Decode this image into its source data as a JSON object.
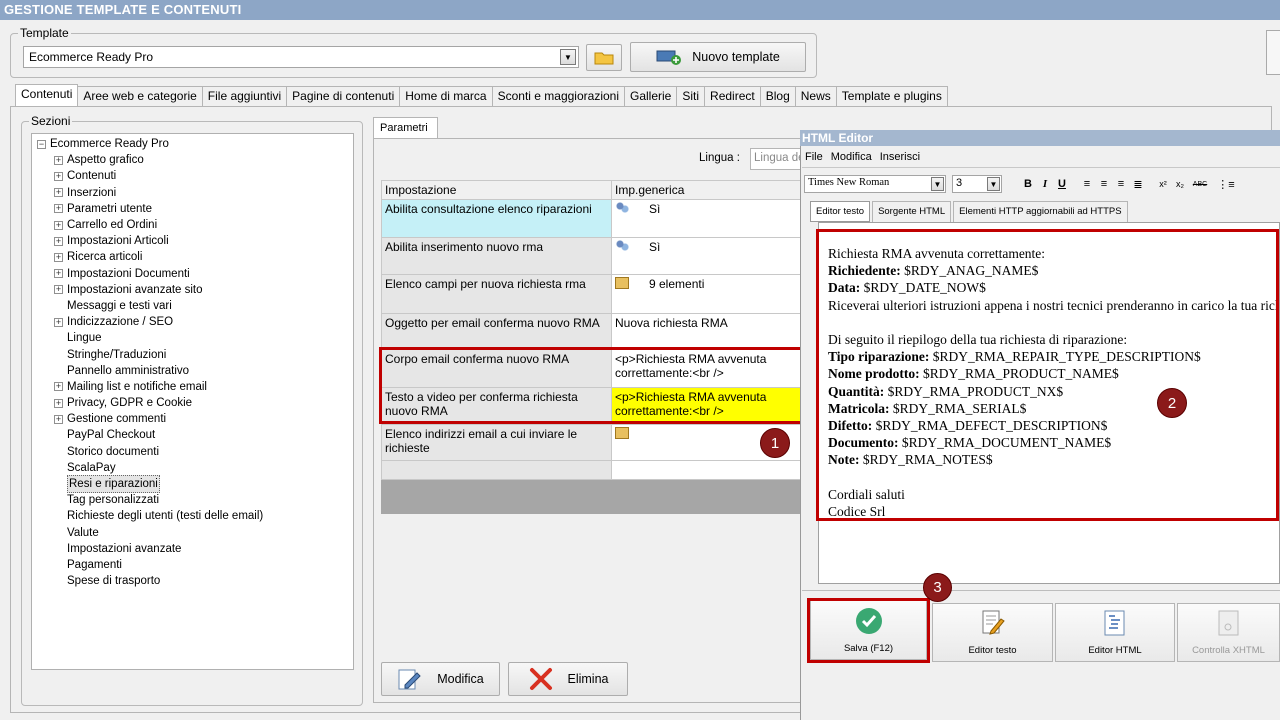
{
  "window": {
    "title": "GESTIONE TEMPLATE E CONTENUTI"
  },
  "template_group": {
    "label": "Template",
    "selected": "Ecommerce Ready Pro",
    "new_button": "Nuovo template"
  },
  "main_tabs": [
    "Contenuti",
    "Aree web e categorie",
    "File aggiuntivi",
    "Pagine di contenuti",
    "Home di marca",
    "Sconti e maggiorazioni",
    "Gallerie",
    "Siti",
    "Redirect",
    "Blog",
    "News",
    "Template e plugins"
  ],
  "sections": {
    "label": "Sezioni",
    "root": "Ecommerce Ready Pro",
    "items": [
      {
        "label": "Aspetto grafico",
        "expandable": true
      },
      {
        "label": "Contenuti",
        "expandable": true
      },
      {
        "label": "Inserzioni",
        "expandable": true
      },
      {
        "label": "Parametri utente",
        "expandable": true
      },
      {
        "label": "Carrello ed Ordini",
        "expandable": true
      },
      {
        "label": "Impostazioni Articoli",
        "expandable": true
      },
      {
        "label": "Ricerca articoli",
        "expandable": true
      },
      {
        "label": "Impostazioni Documenti",
        "expandable": true
      },
      {
        "label": "Impostazioni avanzate sito",
        "expandable": true
      },
      {
        "label": "Messaggi e testi vari",
        "expandable": false
      },
      {
        "label": "Indicizzazione / SEO",
        "expandable": true
      },
      {
        "label": "Lingue",
        "expandable": false
      },
      {
        "label": "Stringhe/Traduzioni",
        "expandable": false
      },
      {
        "label": "Pannello amministrativo",
        "expandable": false
      },
      {
        "label": "Mailing list e notifiche email",
        "expandable": true
      },
      {
        "label": "Privacy, GDPR e Cookie",
        "expandable": true
      },
      {
        "label": "Gestione commenti",
        "expandable": true
      },
      {
        "label": "PayPal Checkout",
        "expandable": false
      },
      {
        "label": "Storico documenti",
        "expandable": false
      },
      {
        "label": "ScalaPay",
        "expandable": false
      },
      {
        "label": "Resi e riparazioni",
        "expandable": false,
        "selected": true
      },
      {
        "label": "Tag personalizzati",
        "expandable": false
      },
      {
        "label": "Richieste degli utenti (testi delle email)",
        "expandable": false
      },
      {
        "label": "Valute",
        "expandable": false
      },
      {
        "label": "Impostazioni avanzate",
        "expandable": false
      },
      {
        "label": "Pagamenti",
        "expandable": false
      },
      {
        "label": "Spese di trasporto",
        "expandable": false
      }
    ]
  },
  "params": {
    "tab": "Parametri",
    "lingua_label": "Lingua :",
    "lingua_placeholder": "Lingua de",
    "col_setting": "Impostazione",
    "col_value": "Imp.generica",
    "rows": [
      {
        "setting": "Abilita consultazione elenco riparazioni",
        "value": "Sì"
      },
      {
        "setting": "Abilita inserimento nuovo rma",
        "value": "Sì"
      },
      {
        "setting": "Elenco campi per nuova richiesta rma",
        "value": "9 elementi"
      },
      {
        "setting": "Oggetto per email conferma nuovo RMA",
        "value": "Nuova richiesta RMA"
      },
      {
        "setting": "Corpo email conferma nuovo RMA",
        "value": "<p>Richiesta RMA avvenuta correttamente:<br />"
      },
      {
        "setting": "Testo a video per conferma richiesta nuovo RMA",
        "value": "<p>Richiesta RMA avvenuta correttamente:<br />"
      },
      {
        "setting": "Elenco indirizzi email a cui inviare le richieste",
        "value": ""
      }
    ],
    "modify_button": "Modifica",
    "delete_button": "Elimina"
  },
  "callouts": [
    "1",
    "2",
    "3"
  ],
  "html_editor": {
    "title": "HTML Editor",
    "menu": [
      "File",
      "Modifica",
      "Inserisci"
    ],
    "font": "Times New Roman",
    "size": "3",
    "tabs": [
      "Editor testo",
      "Sorgente HTML",
      "Elementi HTTP aggiornabili ad HTTPS"
    ],
    "content": [
      {
        "b": "",
        "t": "Richiesta RMA avvenuta correttamente:"
      },
      {
        "b": "Richiedente:",
        "t": " $RDY_ANAG_NAME$"
      },
      {
        "b": "Data:",
        "t": " $RDY_DATE_NOW$"
      },
      {
        "b": "",
        "t": "Riceverai ulteriori istruzioni appena i nostri tecnici prenderanno in carico la tua richi"
      },
      {
        "b": "",
        "t": ""
      },
      {
        "b": "",
        "t": "Di seguito il riepilogo della tua richiesta di riparazione:"
      },
      {
        "b": "Tipo riparazione:",
        "t": " $RDY_RMA_REPAIR_TYPE_DESCRIPTION$"
      },
      {
        "b": "Nome prodotto:",
        "t": " $RDY_RMA_PRODUCT_NAME$"
      },
      {
        "b": "Quantità:",
        "t": " $RDY_RMA_PRODUCT_NX$"
      },
      {
        "b": "Matricola:",
        "t": " $RDY_RMA_SERIAL$"
      },
      {
        "b": "Difetto:",
        "t": " $RDY_RMA_DEFECT_DESCRIPTION$"
      },
      {
        "b": "Documento:",
        "t": " $RDY_RMA_DOCUMENT_NAME$"
      },
      {
        "b": "Note:",
        "t": " $RDY_RMA_NOTES$"
      },
      {
        "b": "",
        "t": ""
      },
      {
        "b": "",
        "t": "Cordiali saluti"
      },
      {
        "b": "",
        "t": "Codice Srl"
      }
    ],
    "buttons": [
      "Salva (F12)",
      "Editor testo",
      "Editor HTML",
      "Controlla XHTML"
    ]
  }
}
